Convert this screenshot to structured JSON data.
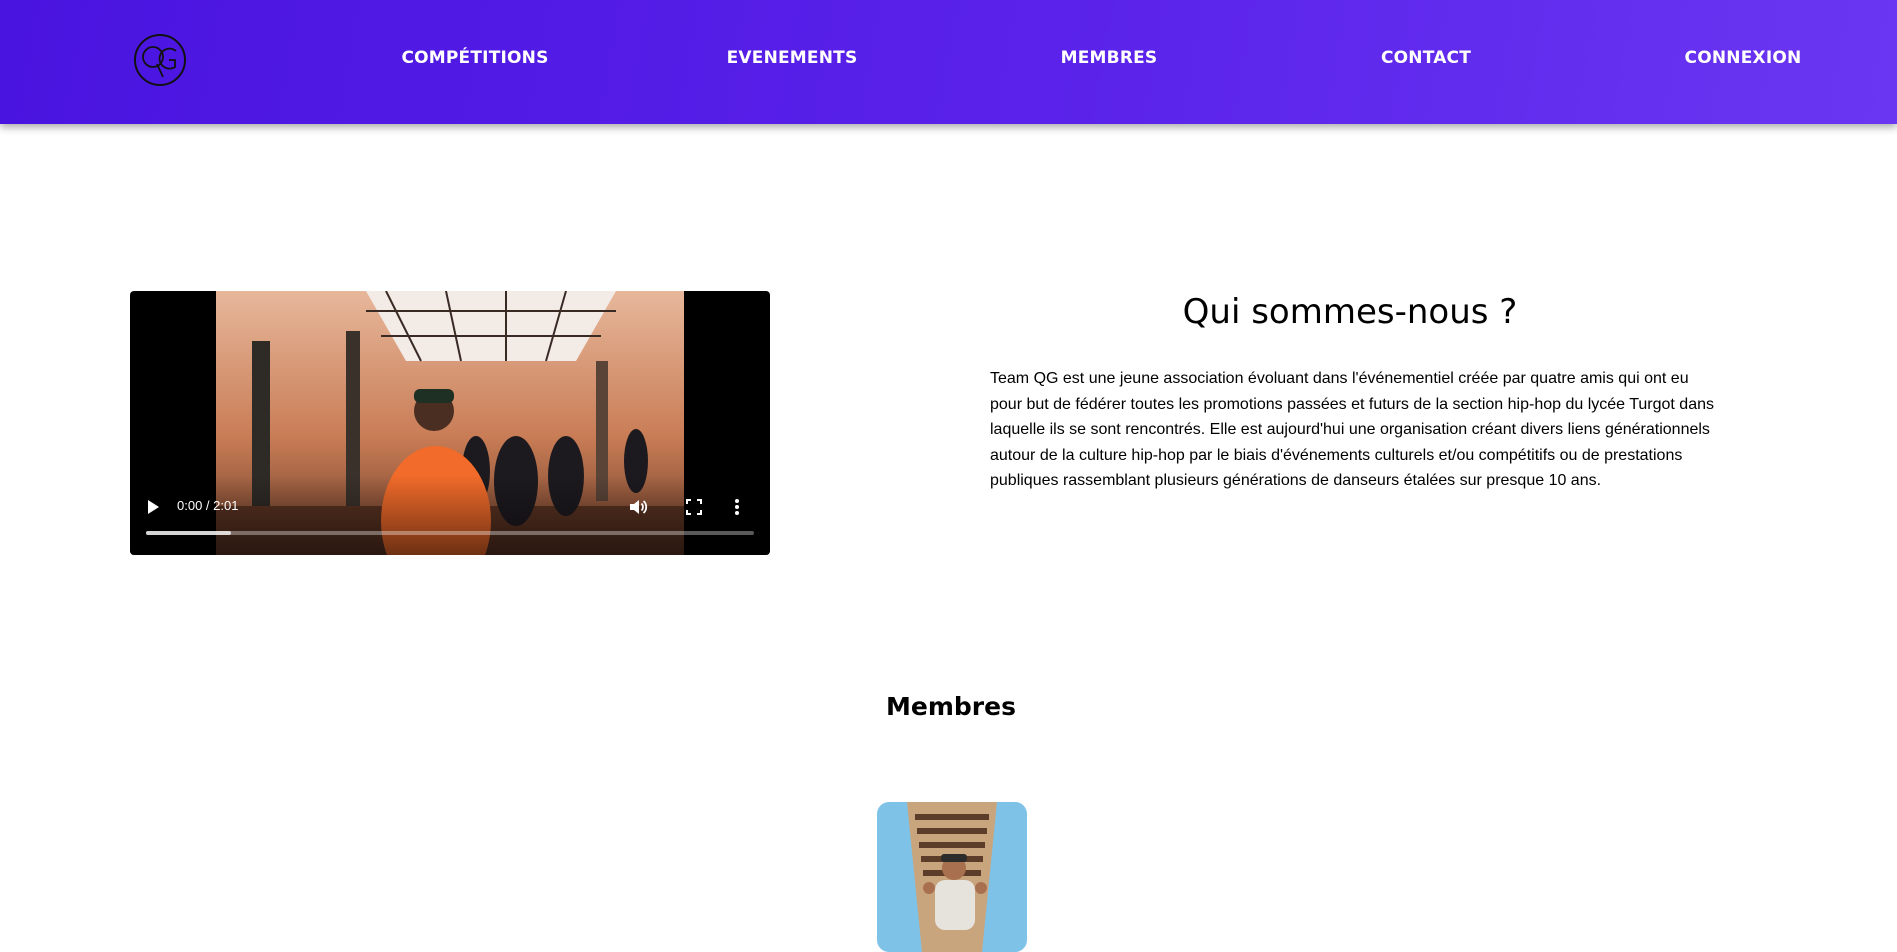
{
  "header": {
    "logo_alt": "QG",
    "nav": [
      {
        "label": "COMPÉTITIONS"
      },
      {
        "label": "EVENEMENTS"
      },
      {
        "label": "MEMBRES"
      },
      {
        "label": "CONTACT"
      },
      {
        "label": "CONNEXION"
      }
    ]
  },
  "video": {
    "time": "0:00 / 2:01",
    "progress": 0.14
  },
  "about": {
    "title": "Qui sommes-nous ?",
    "text": "Team QG est une jeune association évoluant dans l'événementiel créée par quatre amis qui ont eu pour but de fédérer toutes les promotions passées et futurs de la section hip-hop du lycée Turgot dans laquelle ils se sont rencontrés. Elle est aujourd'hui une organisation créant divers liens générationnels autour de la culture hip-hop par le biais d'événements culturels et/ou compétitifs ou de prestations publiques rassemblant plusieurs générations de danseurs étalées sur presque 10 ans."
  },
  "members": {
    "title": "Membres"
  },
  "colors": {
    "header_start": "#4a14e0",
    "header_end": "#6a36f2",
    "nav_text": "#ffffff"
  }
}
